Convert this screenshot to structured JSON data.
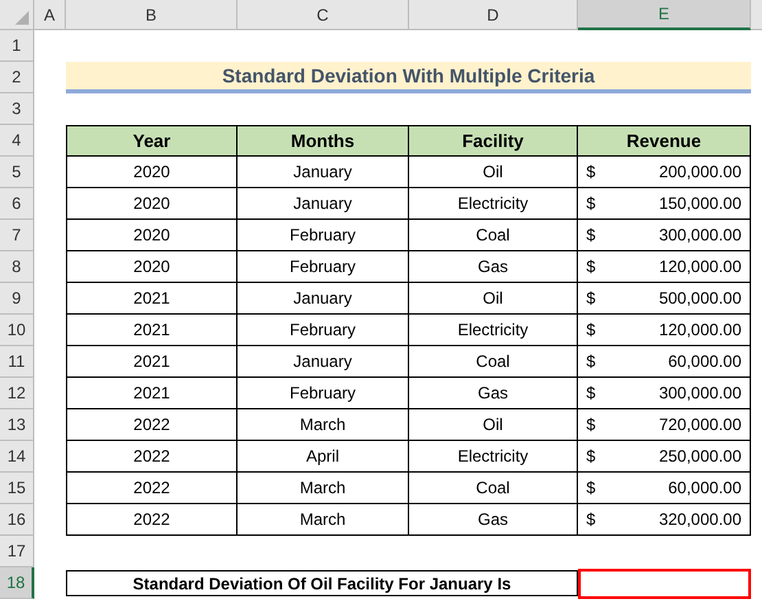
{
  "column_headers": [
    {
      "label": "A",
      "selected": false
    },
    {
      "label": "B",
      "selected": false
    },
    {
      "label": "C",
      "selected": false
    },
    {
      "label": "D",
      "selected": false
    },
    {
      "label": "E",
      "selected": true
    }
  ],
  "row_numbers": [
    {
      "label": "1",
      "selected": false
    },
    {
      "label": "2",
      "selected": false
    },
    {
      "label": "3",
      "selected": false
    },
    {
      "label": "4",
      "selected": false
    },
    {
      "label": "5",
      "selected": false
    },
    {
      "label": "6",
      "selected": false
    },
    {
      "label": "7",
      "selected": false
    },
    {
      "label": "8",
      "selected": false
    },
    {
      "label": "9",
      "selected": false
    },
    {
      "label": "10",
      "selected": false
    },
    {
      "label": "11",
      "selected": false
    },
    {
      "label": "12",
      "selected": false
    },
    {
      "label": "13",
      "selected": false
    },
    {
      "label": "14",
      "selected": false
    },
    {
      "label": "15",
      "selected": false
    },
    {
      "label": "16",
      "selected": false
    },
    {
      "label": "17",
      "selected": false
    },
    {
      "label": "18",
      "selected": true
    }
  ],
  "title": "Standard Deviation With Multiple Criteria",
  "table": {
    "columns": [
      "Year",
      "Months",
      "Facility",
      "Revenue"
    ],
    "rows": [
      {
        "year": "2020",
        "month": "January",
        "facility": "Oil",
        "currency": "$",
        "revenue": "200,000.00"
      },
      {
        "year": "2020",
        "month": "January",
        "facility": "Electricity",
        "currency": "$",
        "revenue": "150,000.00"
      },
      {
        "year": "2020",
        "month": "February",
        "facility": "Coal",
        "currency": "$",
        "revenue": "300,000.00"
      },
      {
        "year": "2020",
        "month": "February",
        "facility": "Gas",
        "currency": "$",
        "revenue": "120,000.00"
      },
      {
        "year": "2021",
        "month": "January",
        "facility": "Oil",
        "currency": "$",
        "revenue": "500,000.00"
      },
      {
        "year": "2021",
        "month": "February",
        "facility": "Electricity",
        "currency": "$",
        "revenue": "120,000.00"
      },
      {
        "year": "2021",
        "month": "January",
        "facility": "Coal",
        "currency": "$",
        "revenue": "60,000.00"
      },
      {
        "year": "2021",
        "month": "February",
        "facility": "Gas",
        "currency": "$",
        "revenue": "300,000.00"
      },
      {
        "year": "2022",
        "month": "March",
        "facility": "Oil",
        "currency": "$",
        "revenue": "720,000.00"
      },
      {
        "year": "2022",
        "month": "April",
        "facility": "Electricity",
        "currency": "$",
        "revenue": "250,000.00"
      },
      {
        "year": "2022",
        "month": "March",
        "facility": "Coal",
        "currency": "$",
        "revenue": "60,000.00"
      },
      {
        "year": "2022",
        "month": "March",
        "facility": "Gas",
        "currency": "$",
        "revenue": "320,000.00"
      }
    ]
  },
  "result": {
    "label": "Standard Deviation Of Oil Facility For January Is",
    "selected": true
  }
}
